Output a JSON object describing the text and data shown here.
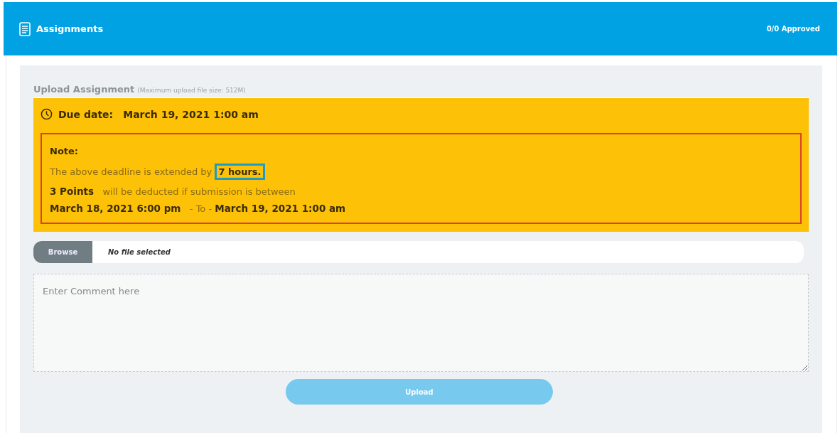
{
  "header": {
    "title": "Assignments",
    "status": "0/0 Approved"
  },
  "upload": {
    "title": "Upload Assignment",
    "hint": "(Maximum upload file size: 512M)",
    "due_label": "Due date:",
    "due_date": "March 19, 2021 1:00 am",
    "note": {
      "title": "Note:",
      "extension_text": "The above deadline is extended by",
      "extension_value": "7 hours.",
      "penalty": "**3 Points**   will be deducted if submission is between",
      "range": "**March 18, 2021 6:00 pm**   - To - **March 19, 2021 1:00 am**"
    },
    "browse_button": "Browse",
    "file_status": "No file selected",
    "comment": {
      "placeholder": "Enter Comment here"
    },
    "upload_button": {
      "label": "Upload",
      "disabled": true
    }
  }
}
